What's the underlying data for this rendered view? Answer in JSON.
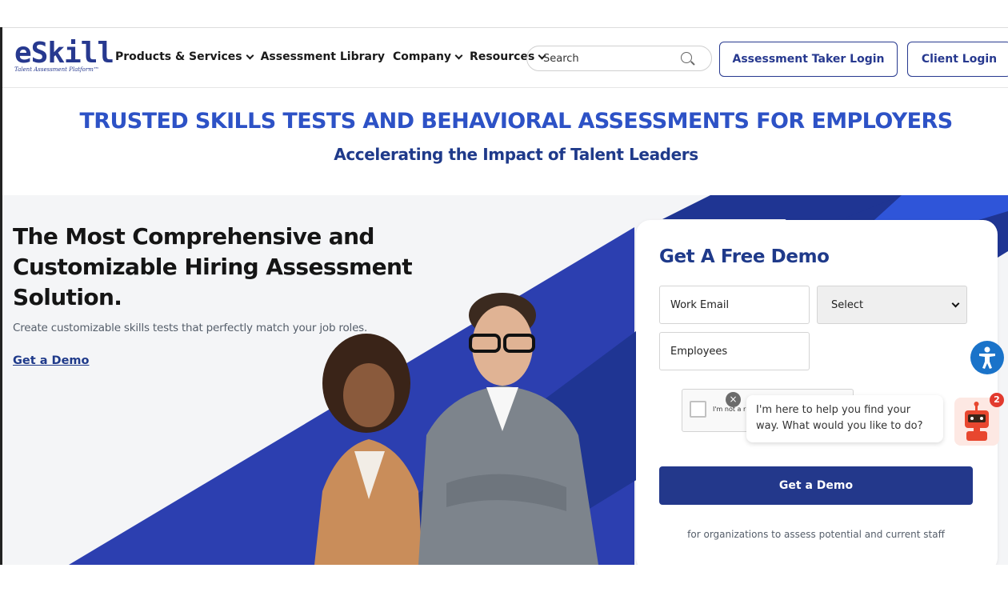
{
  "header": {
    "logo_text": "eSkill",
    "logo_tagline": "Talent Assessment Platform™",
    "nav": [
      {
        "label": "Products & Services",
        "has_dropdown": true
      },
      {
        "label": "Assessment Library",
        "has_dropdown": false
      },
      {
        "label": "Company",
        "has_dropdown": true
      },
      {
        "label": "Resources",
        "has_dropdown": true
      }
    ],
    "search_placeholder": "Search",
    "taker_login_label": "Assessment Taker Login",
    "client_login_label": "Client Login"
  },
  "headline": {
    "title": "TRUSTED SKILLS TESTS AND BEHAVIORAL ASSESSMENTS FOR EMPLOYERS",
    "subtitle": "Accelerating the Impact of Talent Leaders"
  },
  "hero": {
    "title": "The Most Comprehensive and Customizable Hiring Assessment Solution.",
    "description": "Create customizable skills tests that perfectly match your job roles.",
    "link_label": "Get a Demo"
  },
  "demo_form": {
    "title": "Get A Free Demo",
    "email_placeholder": "Work Email",
    "select_value": "Select",
    "employees_placeholder": "Employees",
    "captcha_label": "I'm not a r",
    "submit_label": "Get a Demo",
    "note": "for organizations to assess potential and current staff"
  },
  "chat": {
    "message": "I'm here to help you find your way. What would you like to do?",
    "badge_count": "2",
    "close_symbol": "×"
  },
  "colors": {
    "brand_blue": "#27398f",
    "headline_blue": "#2d52c6",
    "button_navy": "#23388b",
    "accessibility_blue": "#1a73c9",
    "badge_red": "#e23a2e"
  }
}
